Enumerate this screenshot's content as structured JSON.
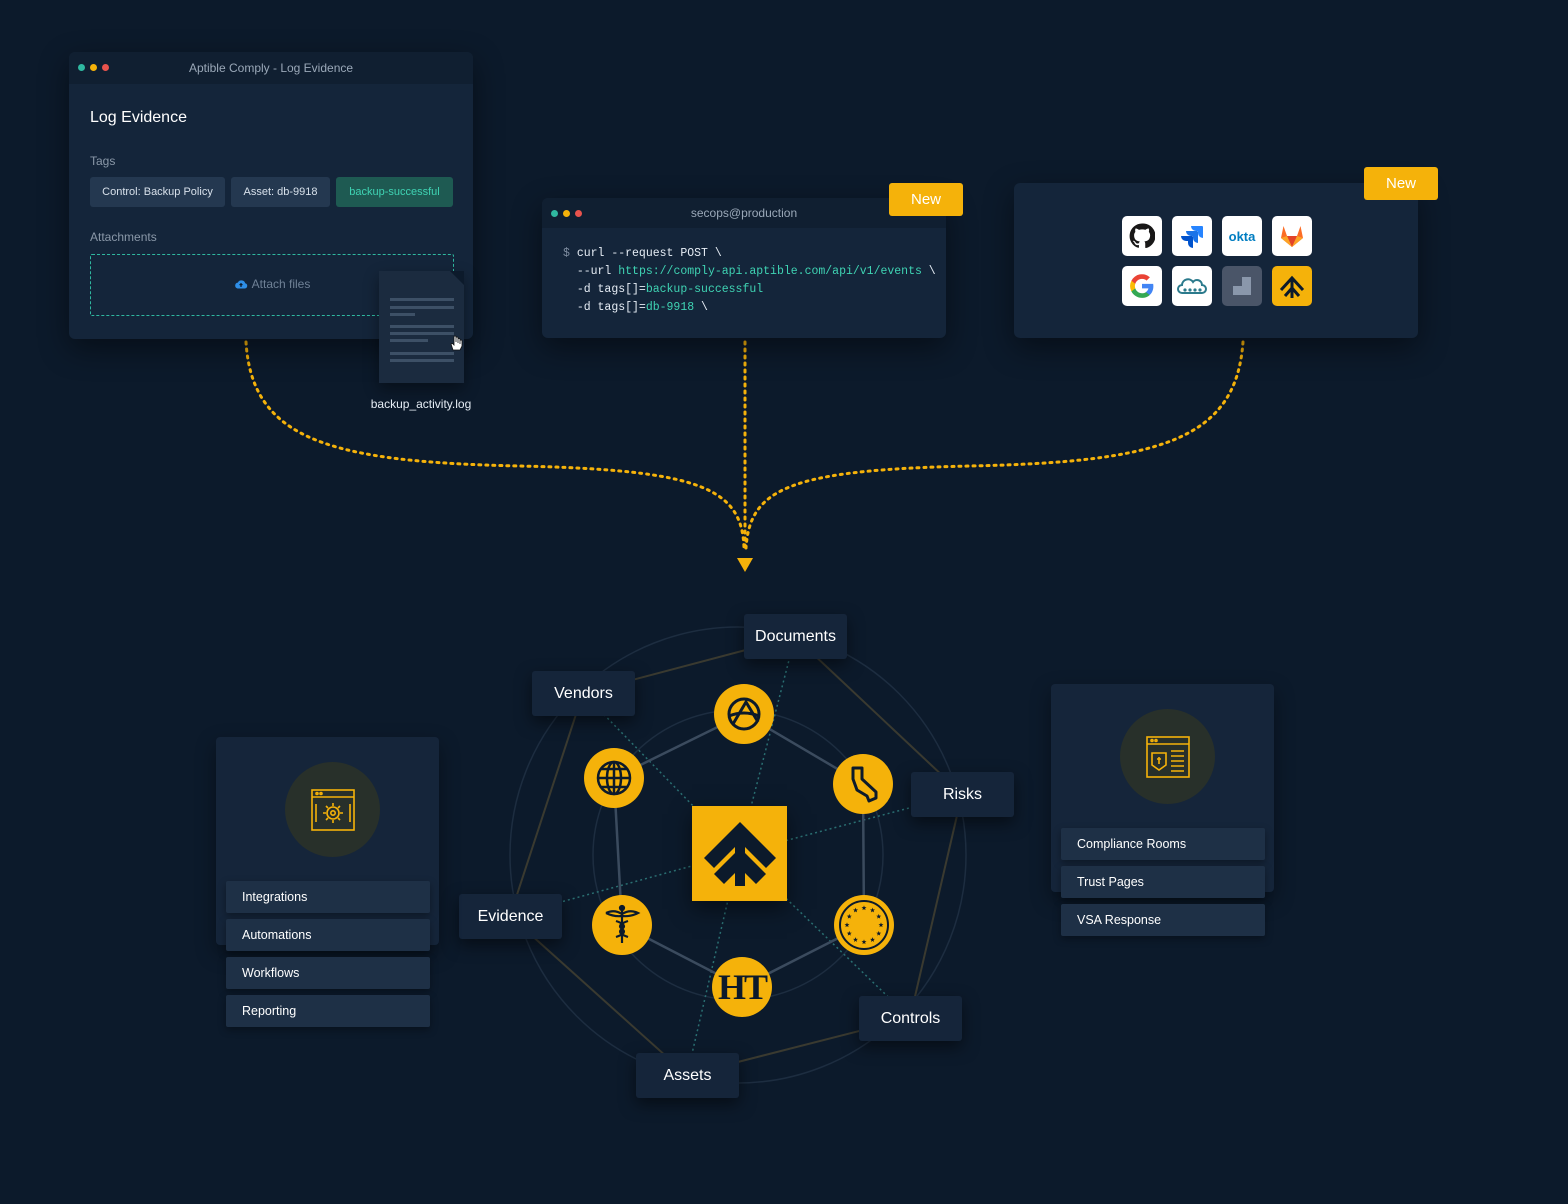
{
  "colors": {
    "background": "#0c1a2b",
    "accent": "#f5b20a",
    "teal": "#2fb8a0",
    "panel": "#14253a"
  },
  "log_window": {
    "title": "Aptible Comply - Log Evidence",
    "heading": "Log Evidence",
    "tags_label": "Tags",
    "tags": [
      "Control: Backup Policy",
      "Asset: db-9918",
      "backup-successful"
    ],
    "attachments_label": "Attachments",
    "attach_files": "Attach files",
    "file_name": "backup_activity.log"
  },
  "terminal": {
    "title": "secops@production",
    "badge": "New",
    "line1_prompt": "$",
    "line1_cmd": "curl --request POST \\",
    "line2_prefix": "--url",
    "line2_url": "https://comply-api.aptible.com/api/v1/events",
    "line2_suffix": "\\",
    "line3_prefix": "-d tags[]=",
    "line3_value": "backup-successful",
    "line4_prefix": "-d tags[]=",
    "line4_value": "db-9918",
    "line4_suffix": "\\"
  },
  "integrations": {
    "badge": "New",
    "icons": [
      "github-icon",
      "jira-icon",
      "okta-icon",
      "gitlab-icon",
      "google-icon",
      "cloud-icon",
      "jamf-icon",
      "aptible-icon"
    ],
    "okta_text": "okta"
  },
  "graph": {
    "nodes": [
      "Documents",
      "Vendors",
      "Risks",
      "Evidence",
      "Controls",
      "Assets"
    ],
    "frameworks": [
      "aicpa-icon",
      "globe-icon",
      "california-icon",
      "caduceus-icon",
      "eu-stars-icon",
      "hitrust-icon"
    ],
    "hitrust_text": "HT"
  },
  "left_panel": {
    "items": [
      "Integrations",
      "Automations",
      "Workflows",
      "Reporting"
    ]
  },
  "right_panel": {
    "items": [
      "Compliance Rooms",
      "Trust Pages",
      "VSA Response"
    ]
  }
}
